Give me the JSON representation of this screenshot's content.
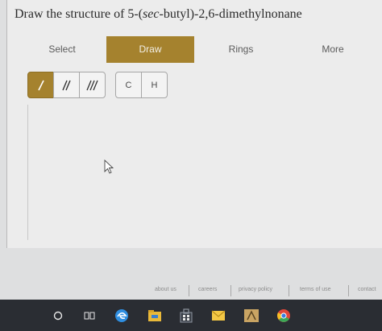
{
  "question": {
    "prefix": "Draw the structure of 5-(",
    "italic": "sec",
    "suffix": "-butyl)-2,6-dimethylnonane"
  },
  "tabs": [
    "Select",
    "Draw",
    "Rings",
    "More"
  ],
  "bond_tools": [
    "/",
    "//",
    "///"
  ],
  "atom_tools": [
    "C",
    "H"
  ],
  "footer_links": [
    "about us",
    "careers",
    "privacy policy",
    "terms of use",
    "contact"
  ],
  "taskbar_icons": [
    "search-icon",
    "task-view-icon",
    "edge-icon",
    "file-explorer-icon",
    "store-icon",
    "mail-icon",
    "app-icon",
    "chrome-icon"
  ],
  "colors": {
    "accent": "#a5822e",
    "taskbar": "#2a2d33"
  }
}
